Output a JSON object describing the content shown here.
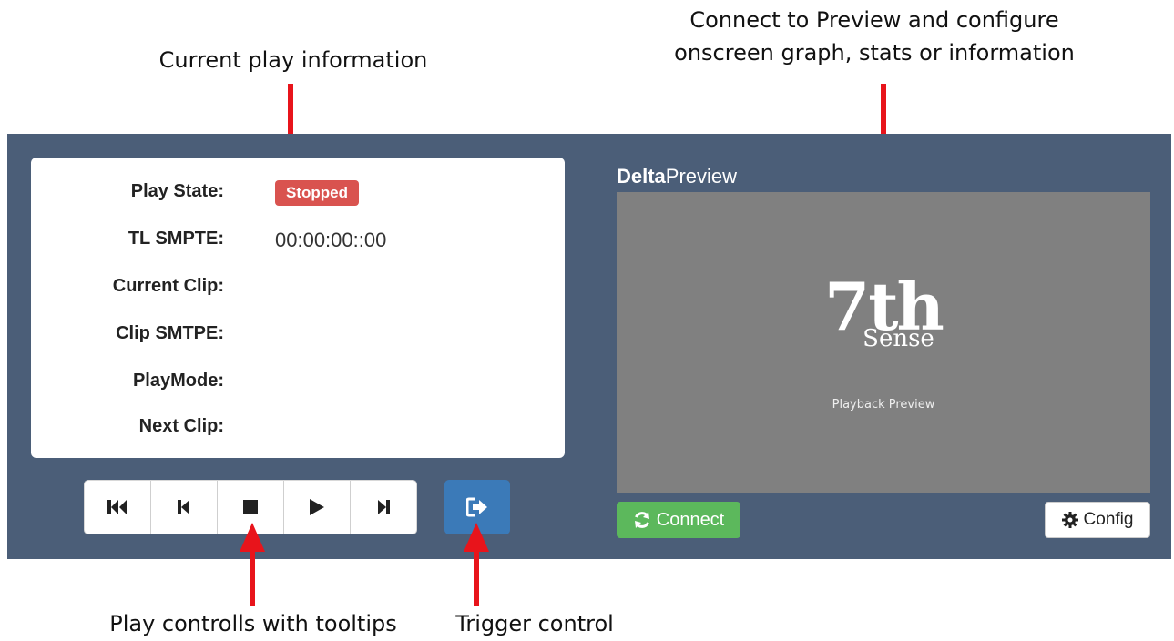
{
  "annotations": {
    "current_play": "Current play information",
    "preview_line1": "Connect to Preview and configure",
    "preview_line2": "onscreen graph, stats or information",
    "play_controls": "Play controlls with tooltips",
    "trigger": "Trigger control"
  },
  "info": {
    "play_state_label": "Play State:",
    "play_state_value": "Stopped",
    "tl_smpte_label": "TL SMPTE:",
    "tl_smpte_value": "00:00:00::00",
    "current_clip_label": "Current Clip:",
    "clip_smpte_label": "Clip SMTPE:",
    "playmode_label": "PlayMode:",
    "next_clip_label": "Next Clip:"
  },
  "controls": {
    "icons": [
      "skip-to-start-icon",
      "step-back-icon",
      "stop-icon",
      "play-icon",
      "step-forward-icon"
    ],
    "trigger_icon": "sign-out-icon"
  },
  "preview": {
    "title_bold": "Delta",
    "title_rest": "Preview",
    "logo_main": "7th",
    "logo_sub": "Sense",
    "caption": "Playback Preview",
    "connect_label": "Connect",
    "config_label": "Config"
  },
  "colors": {
    "panel": "#4b5e78",
    "stopped_badge": "#d9534f",
    "connect": "#5cb85c",
    "trigger": "#3b7ab8",
    "arrows": "#e8141b"
  }
}
